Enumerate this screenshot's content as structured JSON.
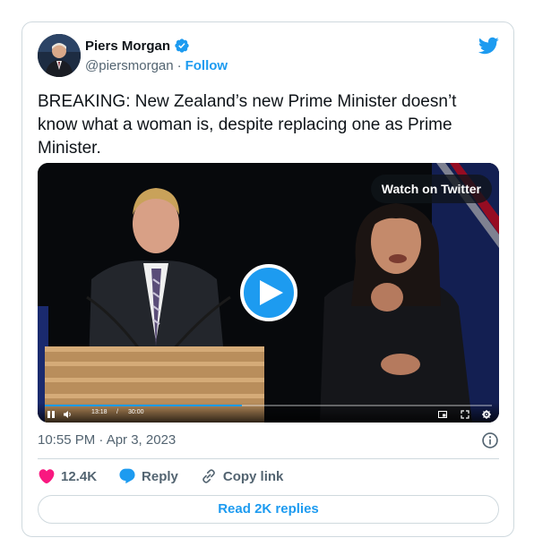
{
  "author": {
    "display_name": "Piers Morgan",
    "handle": "@piersmorgan",
    "separator": "·",
    "follow_label": "Follow",
    "verified": true
  },
  "tweet": {
    "text": "BREAKING: New Zealand’s new Prime Minister doesn’t know what a woman is, despite replacing one as Prime Minister."
  },
  "media": {
    "watch_label": "Watch on Twitter",
    "current_time": "13:18",
    "time_separator": "/",
    "total_time": "30:00",
    "progress_fraction": 0.44
  },
  "meta": {
    "timestamp": "10:55 PM · Apr 3, 2023"
  },
  "actions": {
    "like_count": "12.4K",
    "reply_label": "Reply",
    "copy_label": "Copy link"
  },
  "footer": {
    "read_replies_label": "Read 2K replies"
  },
  "colors": {
    "brand": "#1d9bf0",
    "like": "#f91880",
    "text_secondary": "#536471"
  },
  "icons": [
    "verified-badge-icon",
    "twitter-bird-icon",
    "play-icon",
    "pause-icon",
    "volume-icon",
    "picture-in-picture-icon",
    "fullscreen-icon",
    "settings-gear-icon",
    "info-icon",
    "heart-icon",
    "reply-bubble-icon",
    "link-icon"
  ]
}
